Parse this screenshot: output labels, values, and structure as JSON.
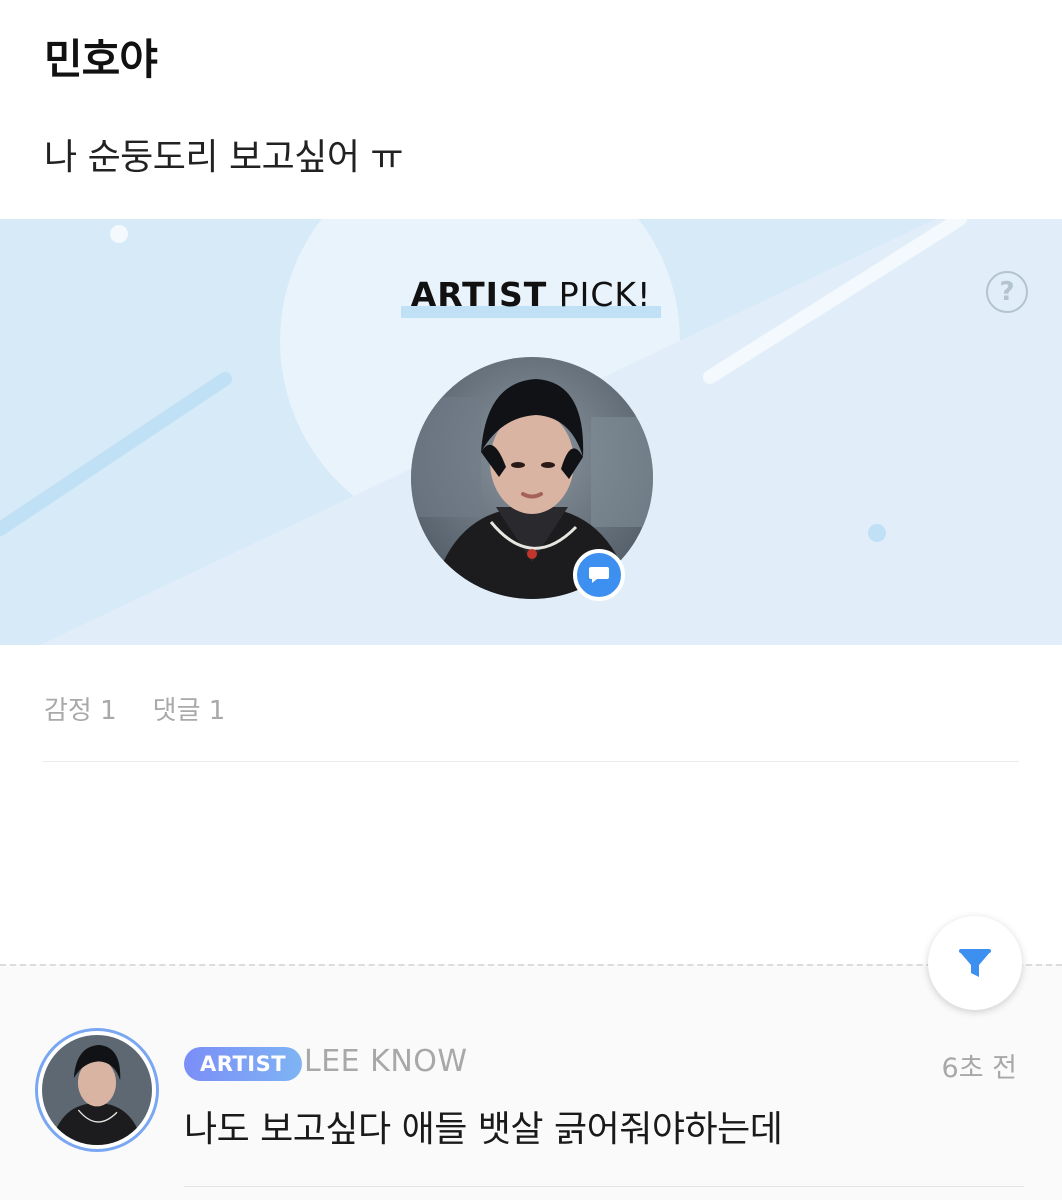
{
  "post": {
    "author": "민호야",
    "body": "나 순둥도리 보고싶어 ㅠ"
  },
  "artist_pick": {
    "title_strong": "ARTIST",
    "title_rest": "PICK!",
    "help_icon": "question-circle-icon",
    "badge_icon": "speech-bubble-icon",
    "colors": {
      "banner_bg": "#d7eaf8",
      "badge": "#3d8ff0"
    }
  },
  "stats": {
    "emotions": "감정 1",
    "comments": "댓글 1"
  },
  "filter_icon": "filter-funnel-icon",
  "comment": {
    "badge": "ARTIST",
    "name": "LEE KNOW",
    "time": "6초 전",
    "text": "나도 보고싶다 애들 뱃살 긁어줘야하는데",
    "colors": {
      "badge_from": "#7b8ef7",
      "badge_to": "#7fb4f4"
    }
  }
}
